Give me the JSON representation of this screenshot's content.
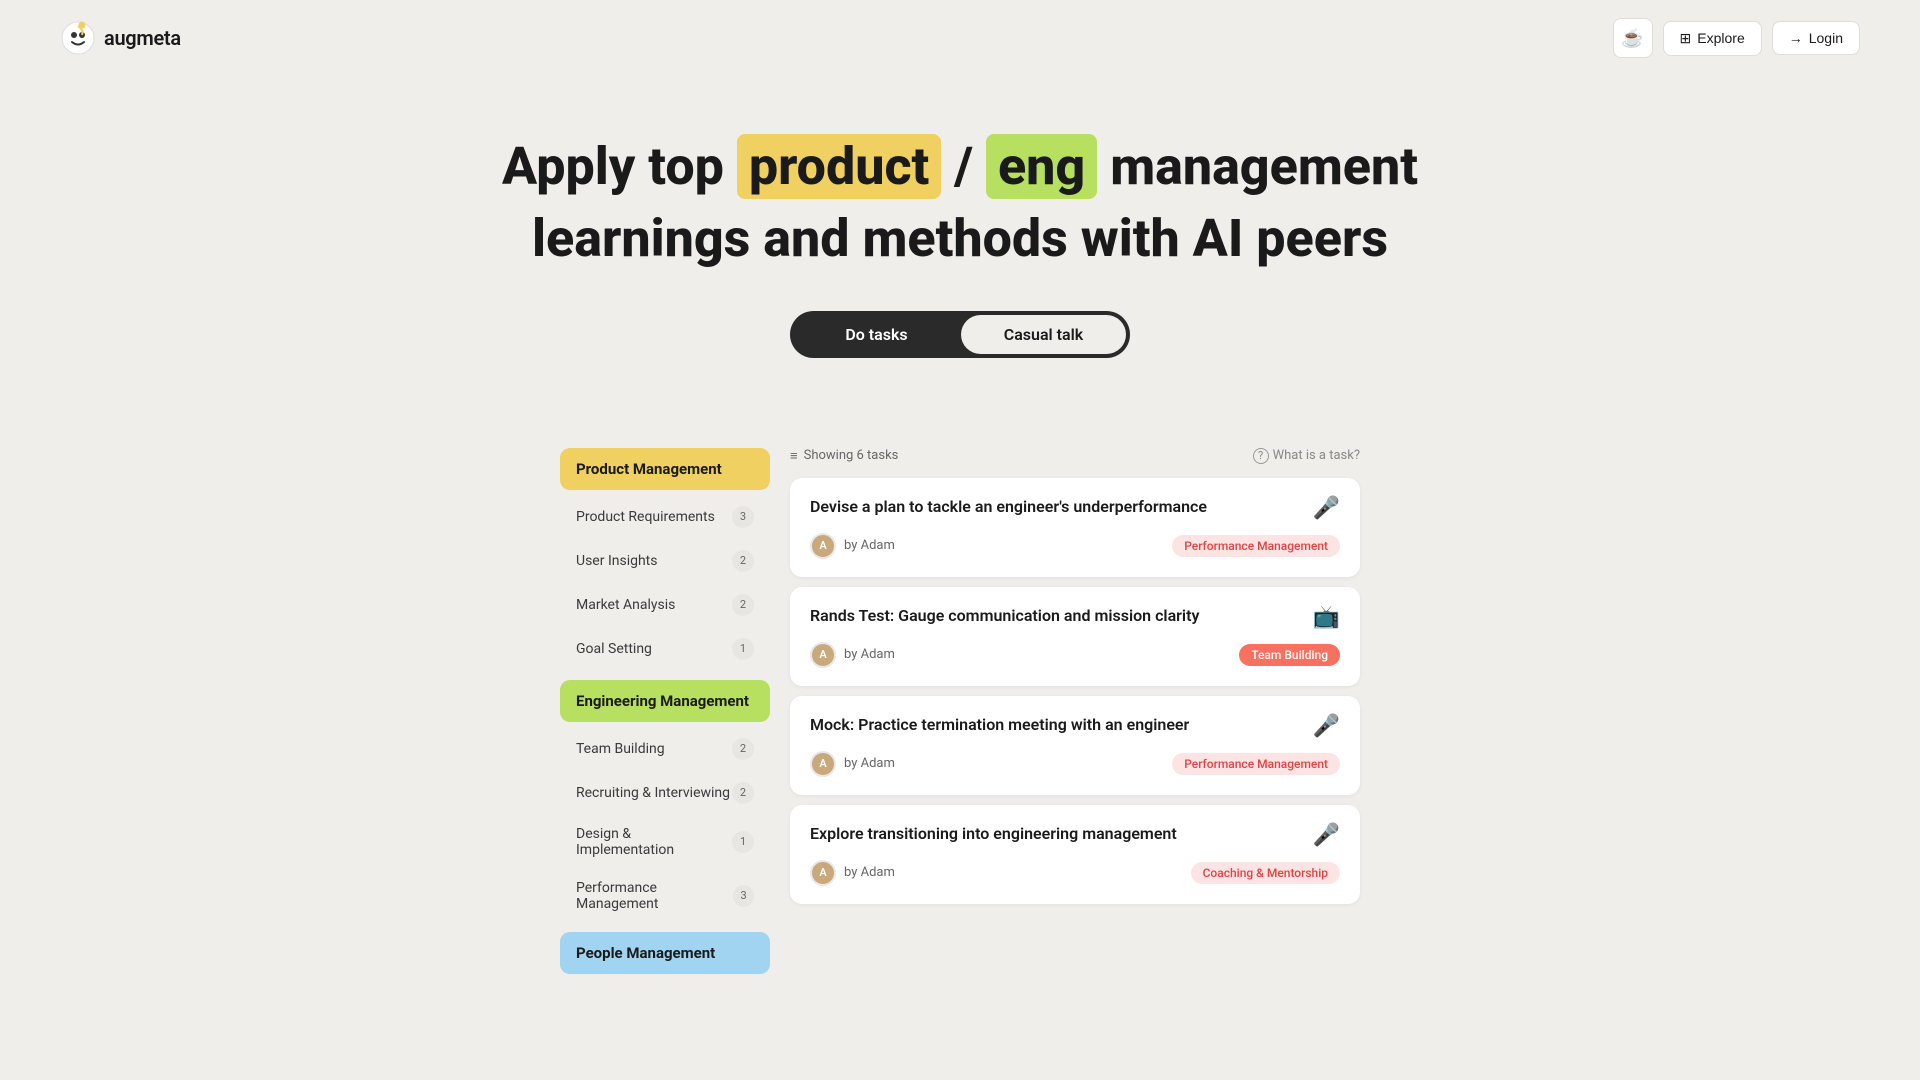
{
  "header": {
    "logo_text": "augmeta",
    "coffee_icon": "☕",
    "explore_label": "Explore",
    "login_label": "Login"
  },
  "hero": {
    "line1_pre": "Apply top",
    "line1_product": "product",
    "line1_slash": "/",
    "line1_eng": "eng",
    "line1_post": "management",
    "line2": "learnings and methods with AI peers"
  },
  "toggle": {
    "do_tasks": "Do tasks",
    "casual_talk": "Casual talk"
  },
  "task_list_header": {
    "showing_label": "Showing 6 tasks",
    "what_is_task": "What is a task?"
  },
  "sidebar": {
    "categories": [
      {
        "label": "Product Management",
        "type": "product"
      },
      {
        "label": "Engineering Management",
        "type": "engineering"
      },
      {
        "label": "People Management",
        "type": "people"
      }
    ],
    "product_items": [
      {
        "label": "Product Requirements",
        "count": ""
      },
      {
        "label": "User Insights",
        "count": ""
      },
      {
        "label": "Market Analysis",
        "count": ""
      },
      {
        "label": "Goal Setting",
        "count": ""
      }
    ],
    "engineering_items": [
      {
        "label": "Team Building",
        "count": ""
      },
      {
        "label": "Recruiting & Interviewing",
        "count": ""
      },
      {
        "label": "Design & Implementation",
        "count": ""
      },
      {
        "label": "Performance Management",
        "count": ""
      }
    ]
  },
  "tasks": [
    {
      "title": "Devise a plan to tackle an engineer's underperformance",
      "author": "by Adam",
      "tag": "Performance Management",
      "tag_type": "performance",
      "icon": "mic"
    },
    {
      "title": "Rands Test: Gauge communication and mission clarity",
      "author": "by Adam",
      "tag": "Team Building",
      "tag_type": "team",
      "icon": "screen"
    },
    {
      "title": "Mock: Practice termination meeting with an engineer",
      "author": "by Adam",
      "tag": "Performance Management",
      "tag_type": "performance",
      "icon": "mic"
    },
    {
      "title": "Explore transitioning into engineering management",
      "author": "by Adam",
      "tag": "Coaching & Mentorship",
      "tag_type": "coaching",
      "icon": "mic"
    }
  ]
}
